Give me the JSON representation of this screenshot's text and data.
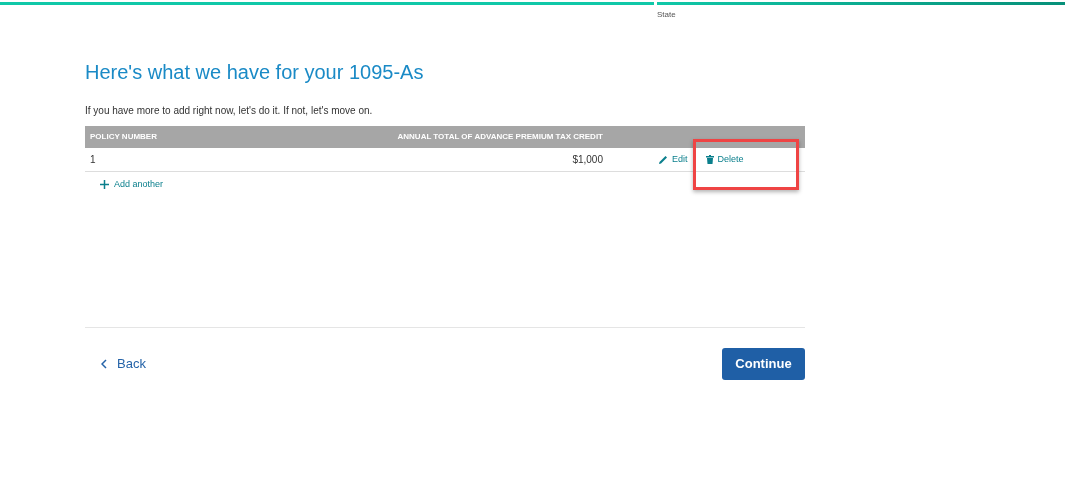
{
  "progress": [
    {
      "level": 1
    },
    {
      "label": "State",
      "level": 1
    }
  ],
  "title": "Here's what we have for your 1095-As",
  "intro": "If you have more to add right now, let's do it. If not, let's move on.",
  "table": {
    "columns": [
      "POLICY NUMBER",
      "ANNUAL TOTAL OF ADVANCE PREMIUM TAX CREDIT"
    ],
    "rows": [
      {
        "policy_number": "1",
        "amount": "$1,000",
        "edit": "Edit",
        "delete": "Delete",
        "highlighted": true
      }
    ]
  },
  "add_another": "Add another",
  "back": "Back",
  "continue": "Continue"
}
